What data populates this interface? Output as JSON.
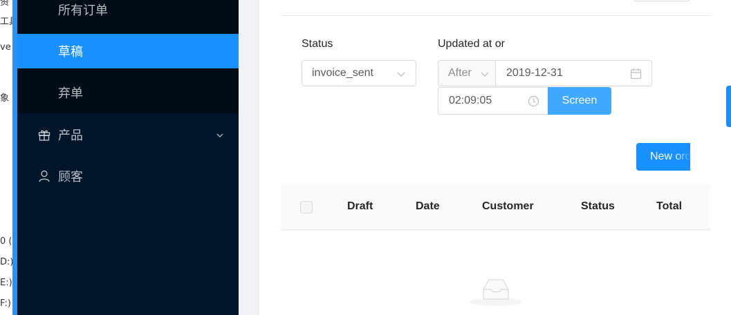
{
  "desktop_strip": {
    "fragments": [
      "资",
      "工具",
      "ve",
      "象",
      "0 (",
      "D:)",
      "E:)",
      "F:)"
    ]
  },
  "sidebar": {
    "sub_items": [
      {
        "label": "所有订单",
        "active": false
      },
      {
        "label": "草稿",
        "active": true
      },
      {
        "label": "弃单",
        "active": false
      }
    ],
    "items": [
      {
        "label": "产品",
        "icon": "gift-icon",
        "expandable": true
      },
      {
        "label": "顾客",
        "icon": "user-icon",
        "expandable": false
      }
    ]
  },
  "filters": {
    "status_label": "Status",
    "status_value": "invoice_sent",
    "updated_label": "Updated at or",
    "comparator": "After",
    "date_value": "2019-12-31",
    "time_value": "02:09:05",
    "screen_button": "Screen"
  },
  "new_order_button": "New order",
  "table": {
    "columns": [
      "Draft",
      "Date",
      "Customer",
      "Status",
      "Total"
    ]
  },
  "colors": {
    "sidebar_bg": "#001529",
    "submenu_bg": "#000c17",
    "primary": "#1890ff",
    "screen_button": "#40a9ff"
  }
}
